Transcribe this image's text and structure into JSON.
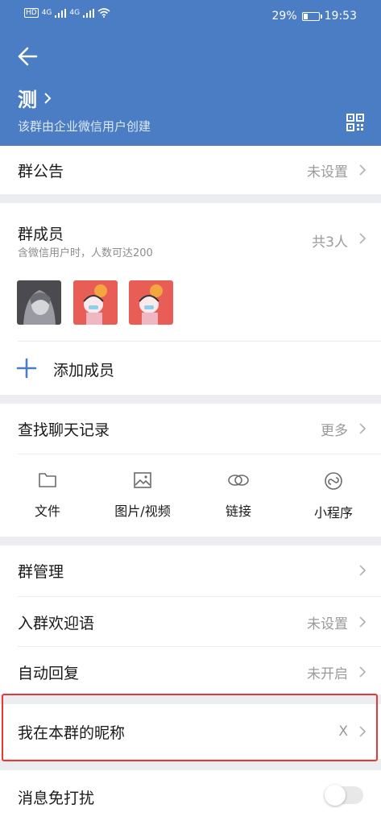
{
  "status_bar": {
    "network_labels": [
      "HD",
      "HD",
      "4G",
      "4G"
    ],
    "battery_percent": "29%",
    "battery_level": 0.29,
    "time": "19:53"
  },
  "header": {
    "title": "测",
    "subtitle": "该群由企业微信用户创建",
    "background_color": "#4a7dc4"
  },
  "announcement": {
    "label": "群公告",
    "value": "未设置"
  },
  "members": {
    "label": "群成员",
    "subtitle": "含微信用户时，人数可达200",
    "count": "共3人",
    "add_label": "添加成员"
  },
  "chat_history": {
    "label": "查找聊天记录",
    "more": "更多",
    "tools": [
      {
        "icon": "folder-icon",
        "label": "文件"
      },
      {
        "icon": "image-icon",
        "label": "图片/视频"
      },
      {
        "icon": "link-icon",
        "label": "链接"
      },
      {
        "icon": "mini-program-icon",
        "label": "小程序"
      }
    ]
  },
  "settings": {
    "group_manage": {
      "label": "群管理"
    },
    "welcome": {
      "label": "入群欢迎语",
      "value": "未设置"
    },
    "auto_reply": {
      "label": "自动回复",
      "value": "未开启"
    },
    "nickname": {
      "label": "我在本群的昵称",
      "value": "X"
    },
    "mute": {
      "label": "消息免打扰",
      "enabled": false
    }
  },
  "colors": {
    "accent": "#4a7dc4",
    "highlight": "#e53935"
  }
}
